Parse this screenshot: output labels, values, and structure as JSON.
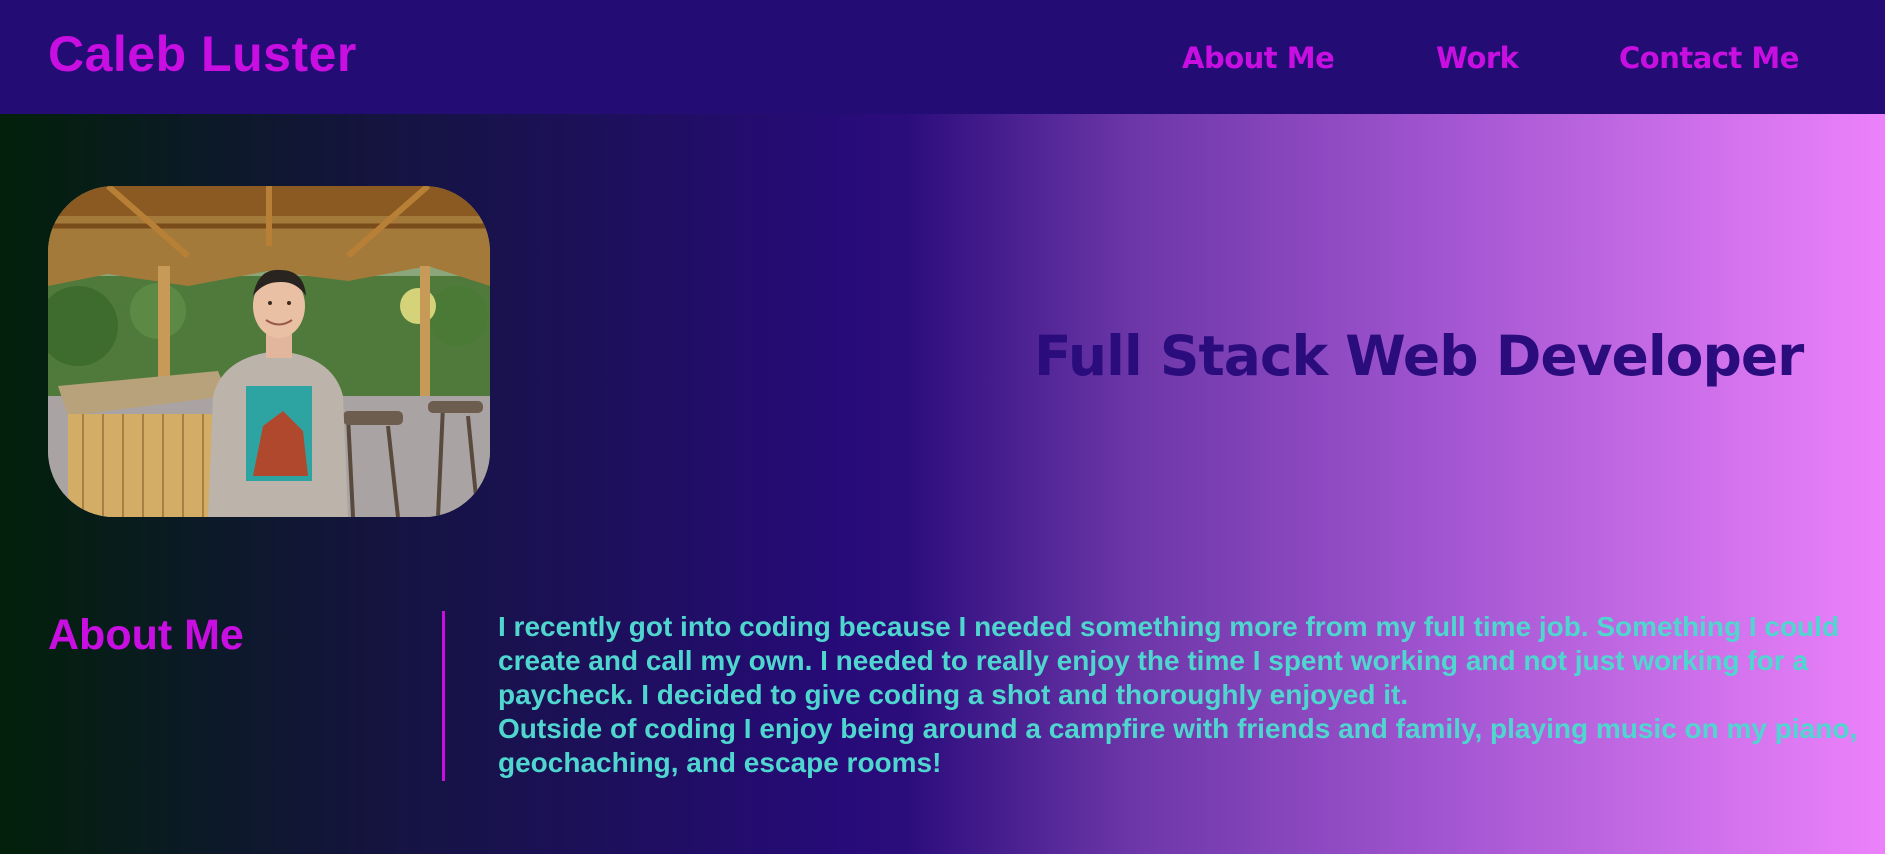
{
  "header": {
    "brand": "Caleb Luster",
    "nav": [
      "About Me",
      "Work",
      "Contact Me"
    ]
  },
  "hero": {
    "photo_alt": "Caleb Luster",
    "tagline": "Full Stack Web Developer"
  },
  "about": {
    "heading": "About Me",
    "paragraphs": [
      "I recently got into coding because I needed something more from my full time job. Something I could create and call my own. I needed to really enjoy the time I spent working and not just working for a paycheck. I decided to give coding a shot and thoroughly enjoyed it.",
      "Outside of coding I enjoy being around a campfire with friends and family, playing music on my piano, geochaching, and escape rooms!"
    ]
  },
  "colors": {
    "header_bg": "#230c73",
    "accent": "#c90ee2",
    "tagline": "#2a0c7c",
    "body_text": "#4fd6cf"
  }
}
